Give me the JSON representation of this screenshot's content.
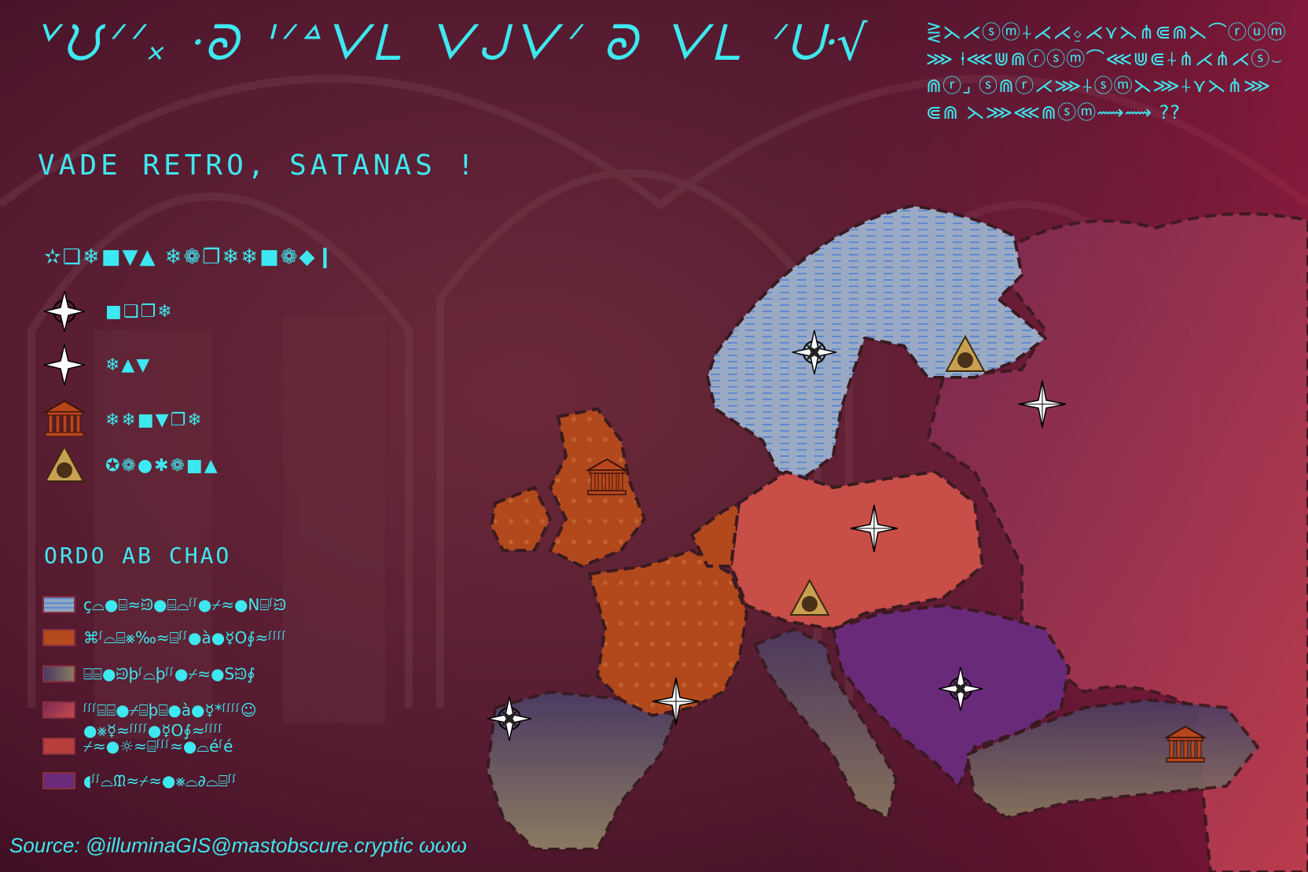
{
  "title": "ᘁᙀᐟᐟ᙮ ᐧᘐ ᑊᐟᐞᐯᒪ ᐯᒍᐯᐟ ᘐ ᐯᒪ ᐟᑘ√",
  "subtitle": "VADE RETRO, SATANAS !",
  "cipher_text": "⋛⋋⋌ⓢⓜ⍭⋌⋌⍚⋌⋎⋋⋔⋐⋒⋋⌒ⓡⓤⓜ⋙ ⍿⋘⋓⋒ⓡⓢⓜ⌒⋘⋓⋐⍭⋔⋌⋔⋌ⓢ⌣⋒ⓡ⌟ ⓢ⋒ⓡ⋌⋙⍭ⓢⓜ⋋⋙⍭⋎⋋⋔⋙⋐⋒ ⋋⋙⋘⋒ⓢⓜ⟿⟿ ??",
  "legend_symbols": {
    "title": "✫❏❄■▼▲ ❄❁❐❄❄■❁◆❙",
    "items": [
      {
        "icon": "compass-rose-icon",
        "label": "■❏❐❄"
      },
      {
        "icon": "four-point-star-icon",
        "label": "❄▲▼"
      },
      {
        "icon": "temple-icon",
        "label": "❄❄■▼❐❄"
      },
      {
        "icon": "eye-triangle-icon",
        "label": "✪❁●✱❁■▲"
      }
    ]
  },
  "legend_fills": {
    "title": "ORDO AB CHAO",
    "items": [
      {
        "label": "ç⌓●⌸≈ᙋ●⌸⌓ᶴᶴ●⌿≈●N⌸ᶴᙋ",
        "color": "#8fa8c0"
      },
      {
        "label": "⌘ᶴ⌓⌸⨳‰≈⌸ᶴᶴ●à●☿O∮≈ᶴᶴᶴᶴ",
        "color": "#b44a1c"
      },
      {
        "label": "⌸⌸●ᙋþᶴ⌓þᶴᶴ●⌿≈●Sᙋ∮",
        "color": "#6a4a6a"
      },
      {
        "label": "ᶴᶴᶴ⌸⌸●⌿⌸þ⌸●à●☿*ᶴᶴᶴᶴ☺●⨳☿≈ᶴᶴᶴᶴ●☿O∮≈ᶴᶴᶴᶴ",
        "color": "#c84a50"
      },
      {
        "label": "⌿≈●☼≈⌸ᶴᶴᶴ≈●⌓éᶴé",
        "color": "#b8403c"
      },
      {
        "label": "◖ᶴᶴ⌓ᙢ≈⌿≈●⨳⌓∂⌓⌸ᶴᶴ",
        "color": "#6a2a7a"
      }
    ]
  },
  "source": "Source: @illuminaGIS@mastobscure.cryptic  ωωω",
  "colors": {
    "text": "#3ee8f0",
    "scandinavia": "#a0b0c8",
    "uk_france": "#b34a1c",
    "germany_poland": "#c8504a",
    "balkans": "#6a2a7a",
    "south": "#5a4a6a"
  }
}
